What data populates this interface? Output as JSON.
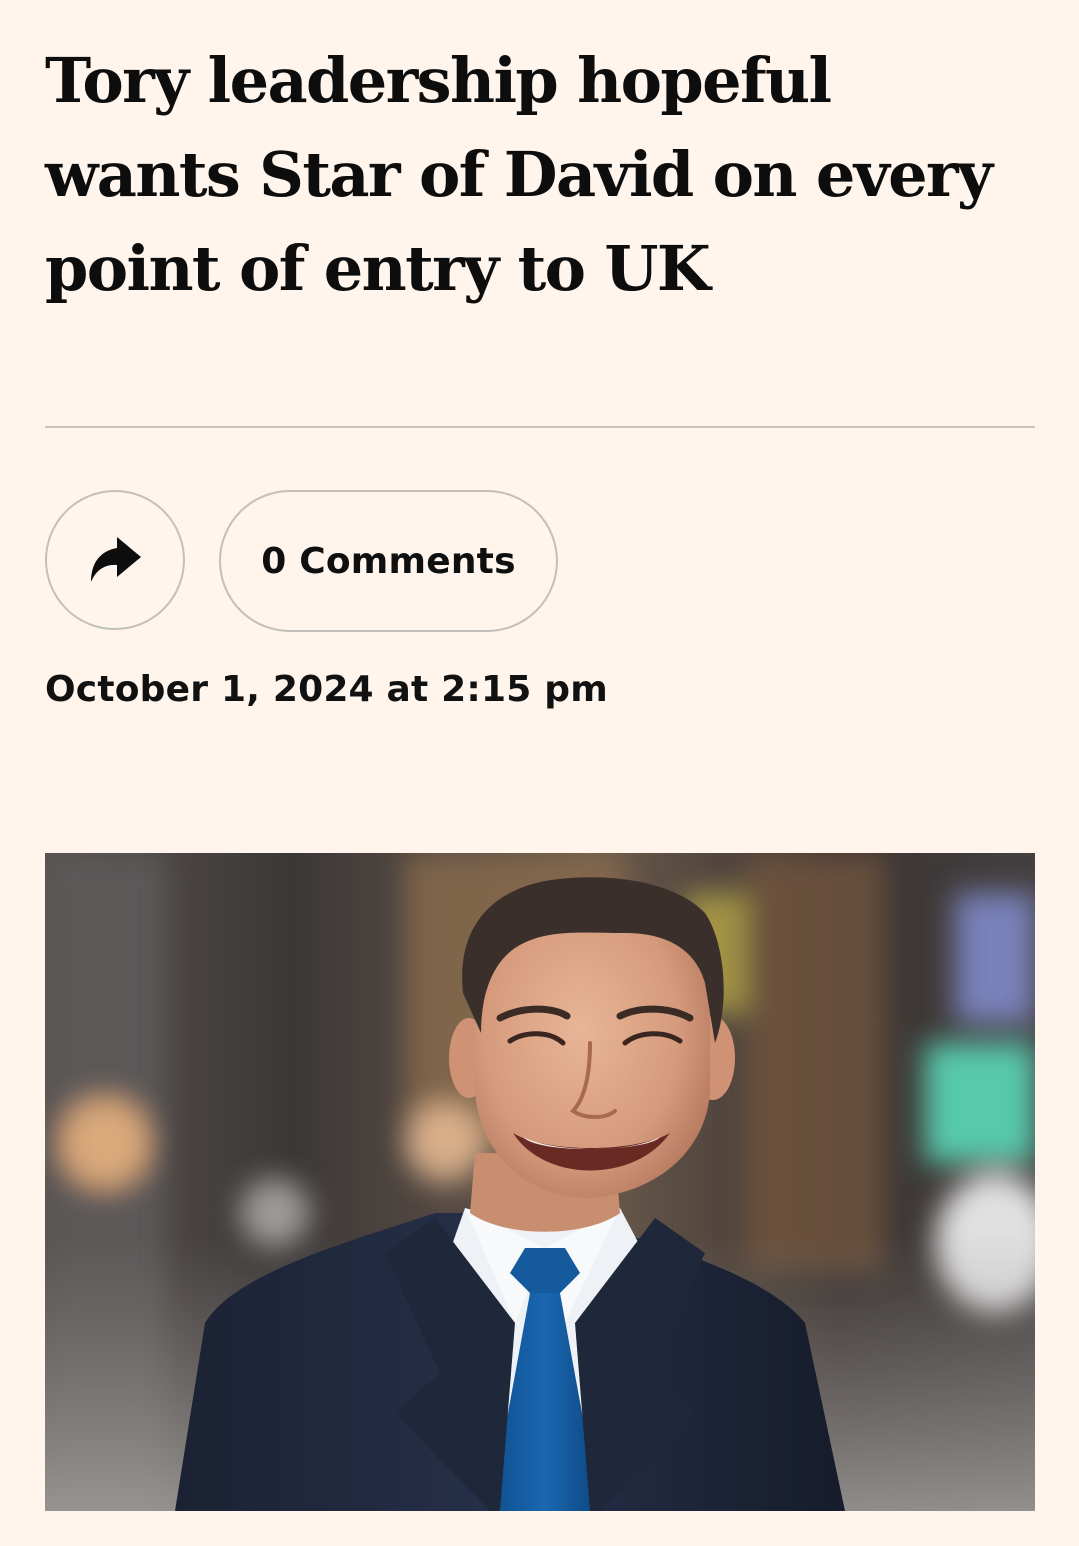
{
  "article": {
    "headline": "Tory leadership hopeful wants Star of David on every point of entry to UK",
    "share_icon": "share-arrow-icon",
    "comments_label": "0 Comments",
    "published": "October 1, 2024 at 2:15 pm",
    "hero_image": "photo of a smiling man in a navy suit and blue tie"
  },
  "colors": {
    "background": "#FFF5EC",
    "text": "#0d0d0d",
    "border": "#c2c0bd"
  }
}
